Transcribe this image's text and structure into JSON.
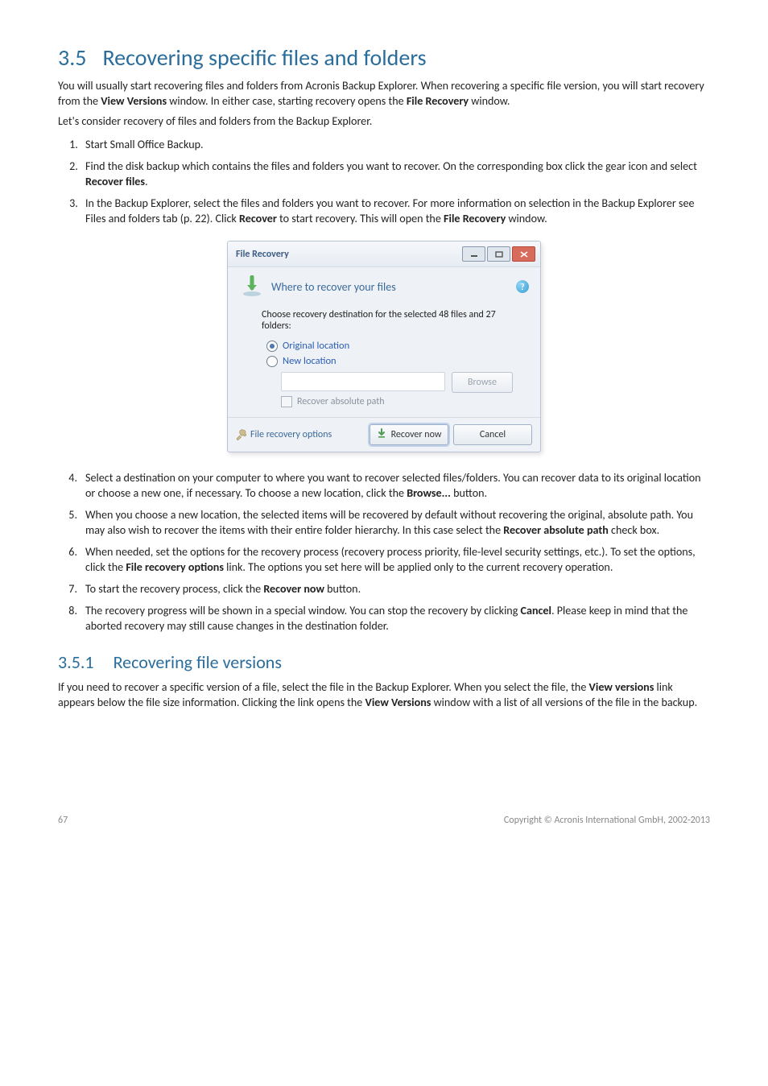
{
  "section": {
    "number": "3.5",
    "title": "Recovering specific files and folders"
  },
  "paragraphs": {
    "p1_a": "You will usually start recovering files and folders from Acronis Backup Explorer. When recovering a specific file version, you will start recovery from the ",
    "p1_bold1": "View Versions",
    "p1_b": " window. In either case, starting recovery opens the ",
    "p1_bold2": "File Recovery",
    "p1_c": " window.",
    "p2": "Let's consider recovery of files and folders from the Backup Explorer."
  },
  "list1": {
    "i1": "Start Small Office Backup.",
    "i2_a": "Find the disk backup which contains the files and folders you want to recover. On the corresponding box click the gear icon and select ",
    "i2_bold": "Recover files",
    "i2_b": ".",
    "i3_a": "In the Backup Explorer, select the files and folders you want to recover. For more information on selection in the Backup Explorer see Files and folders tab (p. 22). Click ",
    "i3_bold1": "Recover",
    "i3_b": " to start recovery. This will open the ",
    "i3_bold2": "File Recovery",
    "i3_c": " window."
  },
  "dialog": {
    "title": "File Recovery",
    "header": "Where to recover your files",
    "instr": "Choose recovery destination for the selected 48 files and 27 folders:",
    "opt1": "Original location",
    "opt2": "New location",
    "browse": "Browse",
    "cb": "Recover absolute path",
    "link": "File recovery options",
    "btn_primary": "Recover now",
    "btn_cancel": "Cancel"
  },
  "list2": {
    "i4_a": "Select a destination on your computer to where you want to recover selected files/folders. You can recover data to its original location or choose a new one, if necessary. To choose a new location, click the ",
    "i4_bold": "Browse...",
    "i4_b": " button.",
    "i5_a": "When you choose a new location, the selected items will be recovered by default without recovering the original, absolute path. You may also wish to recover the items with their entire folder hierarchy. In this case select the ",
    "i5_bold": "Recover absolute path",
    "i5_b": " check box.",
    "i6_a": "When needed, set the options for the recovery process (recovery process priority, file-level security settings, etc.). To set the options, click the ",
    "i6_bold": "File recovery options",
    "i6_b": " link. The options you set here will be applied only to the current recovery operation.",
    "i7_a": "To start the recovery process, click the ",
    "i7_bold": "Recover now",
    "i7_b": " button.",
    "i8_a": "The recovery progress will be shown in a special window. You can stop the recovery by clicking ",
    "i8_bold": "Cancel",
    "i8_b": ". Please keep in mind that the aborted recovery may still cause changes in the destination folder."
  },
  "subsection": {
    "number": "3.5.1",
    "title": "Recovering file versions"
  },
  "subpara": {
    "a": "If you need to recover a specific version of a file, select the file in the Backup Explorer. When you select the file, the ",
    "b1": "View versions",
    "b": " link appears below the file size information. Clicking the link opens the ",
    "b2": "View Versions",
    "c": " window with a list of all versions of the file in the backup."
  },
  "footer": {
    "page": "67",
    "copyright": "Copyright © Acronis International GmbH, 2002-2013"
  }
}
